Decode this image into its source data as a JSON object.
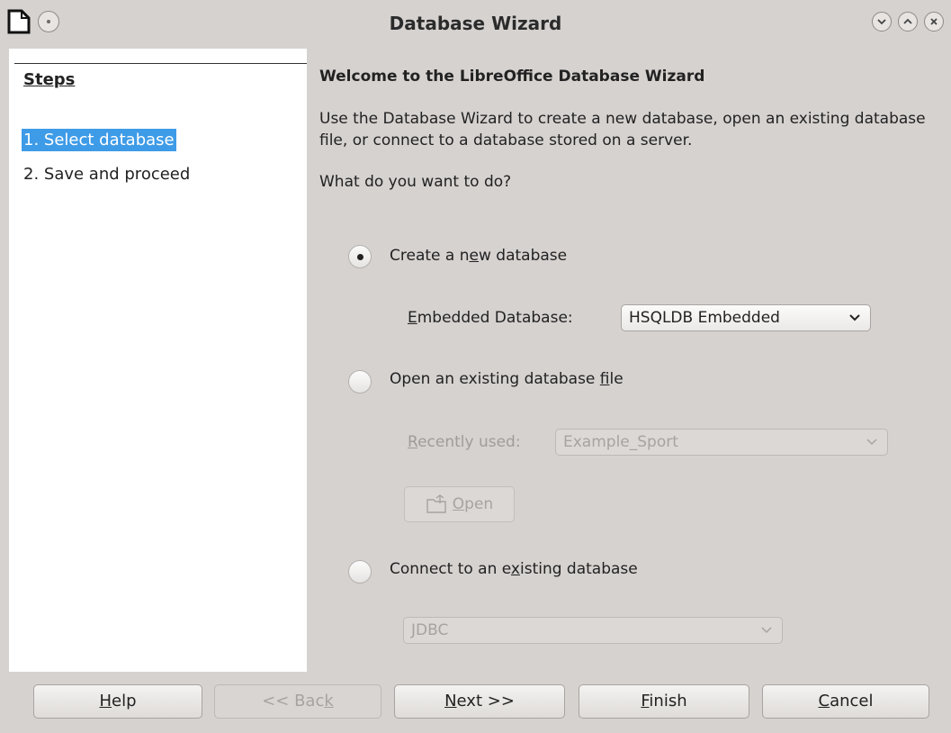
{
  "window": {
    "title": "Database Wizard"
  },
  "steps": {
    "heading": "Steps",
    "items": [
      {
        "label": "1. Select database",
        "active": true
      },
      {
        "label": "2. Save and proceed",
        "active": false
      }
    ]
  },
  "main": {
    "title": "Welcome to the LibreOffice Database Wizard",
    "intro": "Use the Database Wizard to create a new database, open an existing database file, or connect to a database stored on a server.",
    "question": "What do you want to do?",
    "options": {
      "create": {
        "pre": "Create a n",
        "key": "e",
        "post": "w database",
        "selected": true
      },
      "open": {
        "pre": "Open an existing database ",
        "key": "f",
        "post": "ile",
        "selected": false
      },
      "connect": {
        "pre": "Connect to an e",
        "key": "x",
        "post": "isting database",
        "selected": false
      }
    },
    "embedded": {
      "label_key": "E",
      "label_rest": "mbedded Database:",
      "value": "HSQLDB Embedded"
    },
    "recent": {
      "label_key": "R",
      "label_rest": "ecently used:",
      "value": "Example_Sport"
    },
    "open_button": {
      "key": "O",
      "rest": "pen"
    },
    "connection_type": {
      "value": "JDBC"
    }
  },
  "buttons": {
    "help": {
      "key": "H",
      "rest": "elp"
    },
    "back": {
      "pre": "<< Bac",
      "key": "k"
    },
    "next": {
      "key": "N",
      "rest": "ext >>"
    },
    "finish": {
      "key": "F",
      "rest": "inish"
    },
    "cancel": {
      "key": "C",
      "rest": "ancel"
    }
  },
  "colors": {
    "accent": "#3e9be7",
    "window_bg": "#d6d2d0",
    "panel_bg": "#ffffff"
  }
}
